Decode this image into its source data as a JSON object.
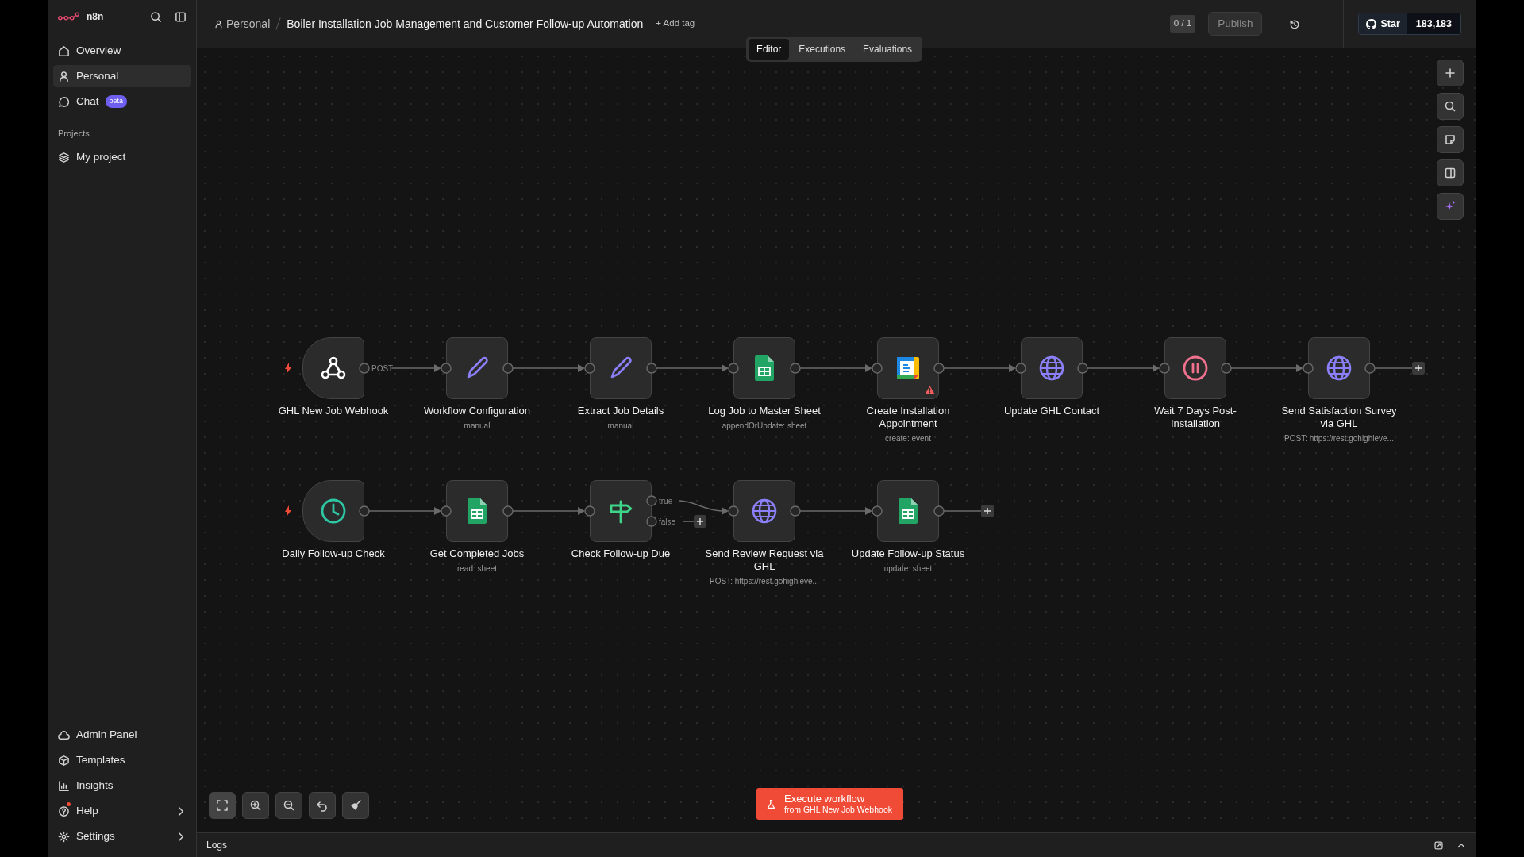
{
  "sidebar": {
    "brand": "n8n",
    "items": [
      {
        "label": "Overview",
        "selected": false
      },
      {
        "label": "Personal",
        "selected": true
      },
      {
        "label": "Chat",
        "badge": "beta",
        "selected": false
      }
    ],
    "projects_heading": "Projects",
    "projects": [
      {
        "label": "My project",
        "selected": false
      }
    ],
    "bottom_items": [
      {
        "label": "Admin Panel",
        "submenu": false,
        "notification": false
      },
      {
        "label": "Templates",
        "submenu": false,
        "notification": false
      },
      {
        "label": "Insights",
        "submenu": false,
        "notification": false
      },
      {
        "label": "Help",
        "submenu": true,
        "notification": true
      },
      {
        "label": "Settings",
        "submenu": true,
        "notification": false
      }
    ]
  },
  "header": {
    "project": "Personal",
    "title": "Boiler Installation Job Management and Customer Follow-up Automation",
    "add_tag": "+ Add tag",
    "view_tabs": [
      {
        "label": "Editor",
        "selected": true
      },
      {
        "label": "Executions",
        "selected": false
      },
      {
        "label": "Evaluations",
        "selected": false
      }
    ],
    "version_counter": "0 / 1",
    "publish": {
      "label": "Publish",
      "disabled": true
    },
    "github": {
      "label": "Star",
      "count": "183,183"
    }
  },
  "canvas": {
    "rows": [
      {
        "nodes": [
          {
            "name": "GHL New Job Webhook",
            "kind": "webhook",
            "trigger": true,
            "warning": false,
            "outputs": [
              {
                "label": "POST",
                "connected": true
              }
            ]
          },
          {
            "name": "Workflow Configuration",
            "subtitle": "manual",
            "kind": "set",
            "trigger": false,
            "warning": false
          },
          {
            "name": "Extract Job Details",
            "subtitle": "manual",
            "kind": "set",
            "trigger": false,
            "warning": false
          },
          {
            "name": "Log Job to Master Sheet",
            "subtitle": "appendOrUpdate: sheet",
            "kind": "sheets",
            "trigger": false,
            "warning": false
          },
          {
            "name": "Create Installation Appointment",
            "subtitle": "create: event",
            "kind": "calendar",
            "trigger": false,
            "warning": true
          },
          {
            "name": "Update GHL Contact",
            "kind": "http",
            "trigger": false,
            "warning": false
          },
          {
            "name": "Wait 7 Days Post-Installation",
            "kind": "wait",
            "trigger": false,
            "warning": false
          },
          {
            "name": "Send Satisfaction Survey via GHL",
            "subtitle": "POST: https://rest.gohighleve...",
            "kind": "http",
            "trigger": false,
            "warning": false
          }
        ]
      },
      {
        "nodes": [
          {
            "name": "Daily Follow-up Check",
            "kind": "schedule",
            "trigger": true,
            "warning": false
          },
          {
            "name": "Get Completed Jobs",
            "subtitle": "read: sheet",
            "kind": "sheets",
            "trigger": false,
            "warning": false
          },
          {
            "name": "Check Follow-up Due",
            "kind": "if",
            "trigger": false,
            "warning": false,
            "outputs": [
              {
                "label": "true",
                "connected": true
              },
              {
                "label": "false",
                "connected": false
              }
            ]
          },
          {
            "name": "Send Review Request via GHL",
            "subtitle": "POST: https://rest.gohighleve...",
            "kind": "http",
            "trigger": false,
            "warning": false
          },
          {
            "name": "Update Follow-up Status",
            "subtitle": "update: sheet",
            "kind": "sheets",
            "trigger": false,
            "warning": false
          }
        ]
      }
    ]
  },
  "execute_button": {
    "label": "Execute workflow",
    "source": "from GHL New Job Webhook"
  },
  "logs": {
    "label": "Logs"
  }
}
